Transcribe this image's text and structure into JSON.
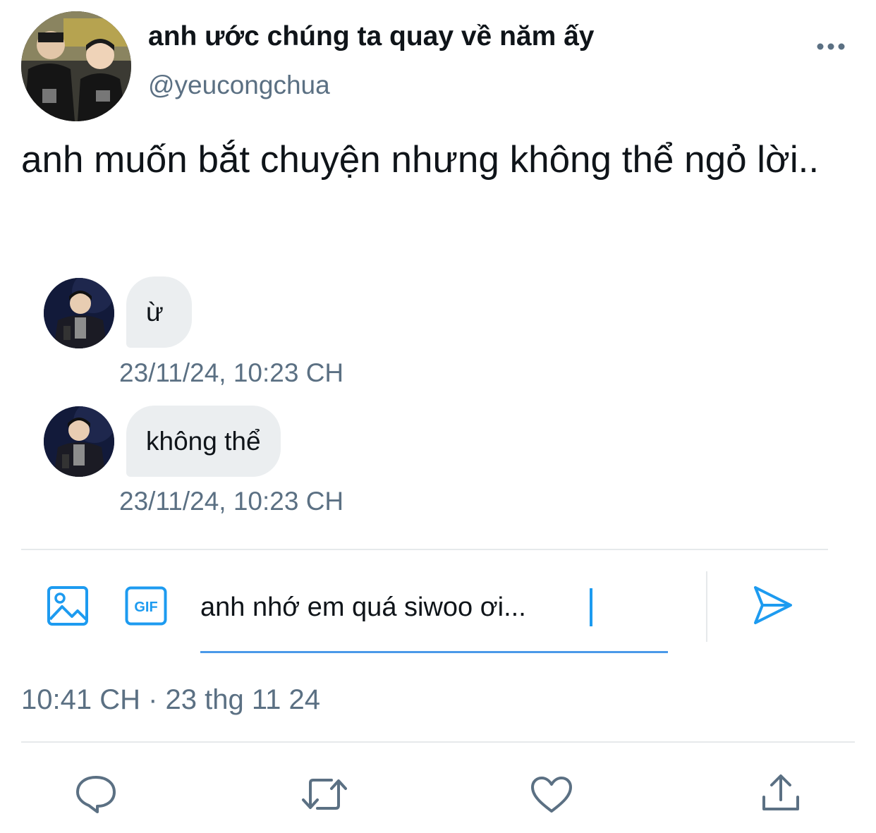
{
  "header": {
    "display_name": "anh ước chúng ta quay về năm ấy",
    "handle": "@yeucongchua"
  },
  "tweet": {
    "text": "anh muốn bắt chuyện nhưng không thể ngỏ lời.."
  },
  "messages": [
    {
      "text": "ừ",
      "timestamp": "23/11/24, 10:23 CH"
    },
    {
      "text": "không thể",
      "timestamp": "23/11/24, 10:23 CH"
    }
  ],
  "composer": {
    "value": "anh nhớ em quá siwoo ơi...",
    "image_icon": "image-icon",
    "gif_label": "GIF",
    "send_icon": "send-icon"
  },
  "post_time": "10:41 CH · 23 thg 11 24",
  "actions": {
    "reply_icon": "reply-icon",
    "retweet_icon": "retweet-icon",
    "like_icon": "heart-icon",
    "share_icon": "share-icon"
  },
  "colors": {
    "accent": "#1d9bf0",
    "muted_text": "#5b7083",
    "bubble_bg": "#ebeef0",
    "divider": "#e6e9eb"
  }
}
